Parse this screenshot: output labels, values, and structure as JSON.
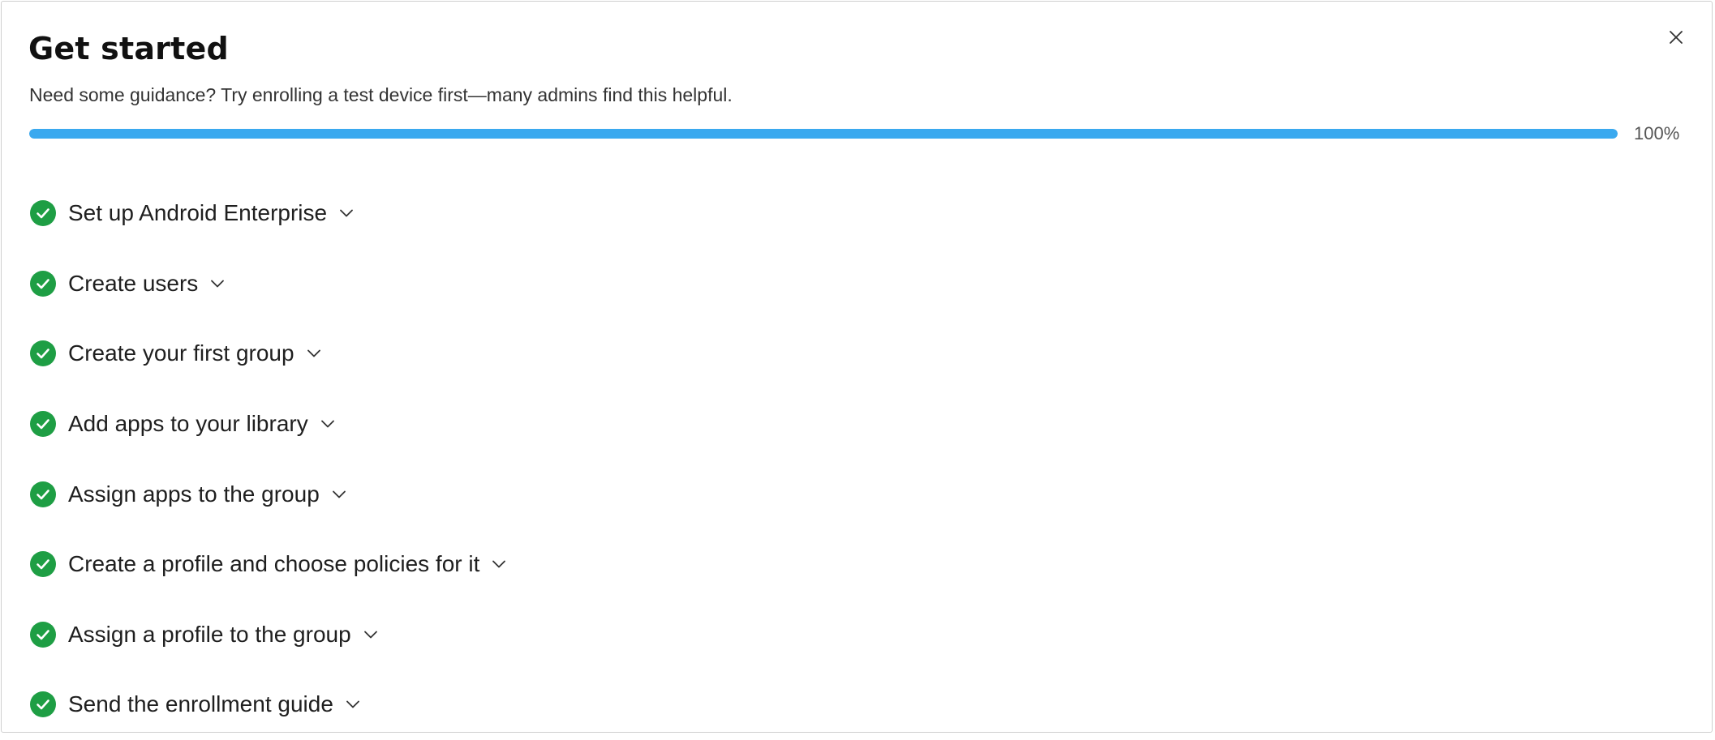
{
  "dialog": {
    "title": "Get started",
    "subtitle": "Need some guidance? Try enrolling a test device first—many admins find this helpful.",
    "close_icon": "close-icon"
  },
  "progress": {
    "value": 100,
    "label": "100%",
    "fill_color": "#3aa9ef",
    "track_color": "#e3e8ee"
  },
  "steps": [
    {
      "label": "Set up Android Enterprise",
      "status": "completed"
    },
    {
      "label": "Create users",
      "status": "completed"
    },
    {
      "label": "Create your first group",
      "status": "completed"
    },
    {
      "label": "Add apps to your library",
      "status": "completed"
    },
    {
      "label": "Assign apps to the group",
      "status": "completed"
    },
    {
      "label": "Create a profile and choose policies for it",
      "status": "completed"
    },
    {
      "label": "Assign a profile to the group",
      "status": "completed"
    },
    {
      "label": "Send the enrollment guide",
      "status": "completed"
    }
  ],
  "icons": {
    "step_status": "check-circle-icon",
    "step_expand": "chevron-down-icon"
  },
  "colors": {
    "check_green": "#1e9e44",
    "accent_blue": "#3aa9ef"
  }
}
